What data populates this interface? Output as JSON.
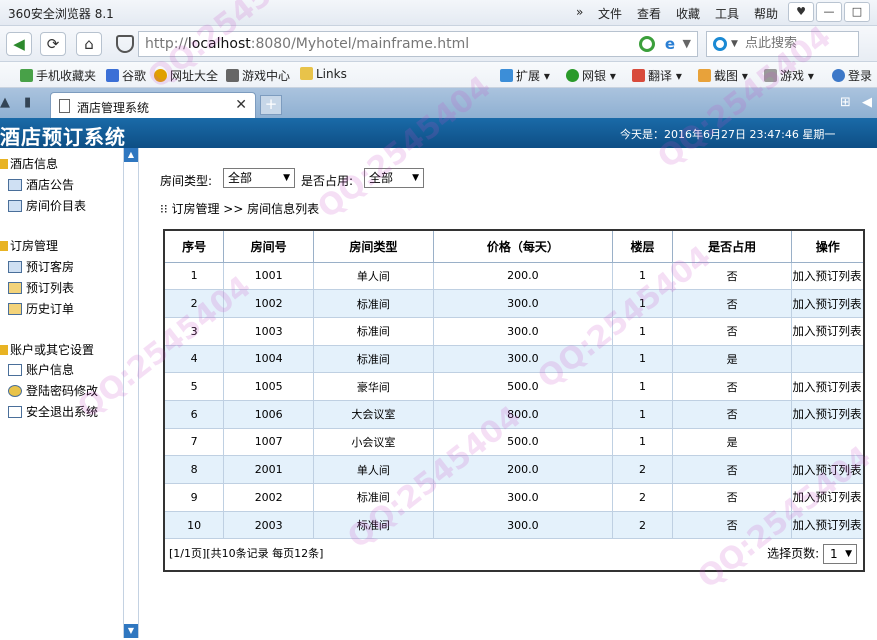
{
  "browser": {
    "title": "360安全浏览器 8.1",
    "menus": [
      "»",
      "文件",
      "查看",
      "收藏",
      "工具",
      "帮助"
    ],
    "window_buttons": [
      "♥",
      "—",
      "□"
    ],
    "url_prefix": "http://",
    "url_host": "localhost",
    "url_rest": ":8080/Myhotel/mainframe.html",
    "search_placeholder": "点此搜索",
    "bookmarks": [
      "手机收藏夹",
      "谷歌",
      "网址大全",
      "游戏中心",
      "Links",
      "扩展",
      "网银",
      "翻译",
      "截图",
      "游戏",
      "登录"
    ],
    "tab_title": "酒店管理系统",
    "new_tab": "+"
  },
  "app": {
    "system_title": "酒店预订系统",
    "date_text": "今天是：2016年6月27日   23:47:46    星期一",
    "sidebar": {
      "groups": [
        {
          "label": "酒店信息",
          "items": [
            "酒店公告",
            "房间价目表"
          ]
        },
        {
          "label": "订房管理",
          "items": [
            "预订客房",
            "预订列表",
            "历史订单"
          ]
        },
        {
          "label": "账户或其它设置",
          "items": [
            "账户信息",
            "登陆密码修改",
            "安全退出系统"
          ]
        }
      ]
    },
    "filters": {
      "room_type_label": "房间类型:",
      "room_type_value": "全部",
      "occupied_label": "是否占用:",
      "occupied_value": "全部"
    },
    "breadcrumb": "⁝⁝ 订房管理 >> 房间信息列表",
    "table": {
      "headers": [
        "序号",
        "房间号",
        "房间类型",
        "价格（每天）",
        "楼层",
        "是否占用",
        "操作"
      ],
      "rows": [
        [
          "1",
          "1001",
          "单人间",
          "200.0",
          "1",
          "否",
          "加入预订列表"
        ],
        [
          "2",
          "1002",
          "标准间",
          "300.0",
          "1",
          "否",
          "加入预订列表"
        ],
        [
          "3",
          "1003",
          "标准间",
          "300.0",
          "1",
          "否",
          "加入预订列表"
        ],
        [
          "4",
          "1004",
          "标准间",
          "300.0",
          "1",
          "是",
          ""
        ],
        [
          "5",
          "1005",
          "豪华间",
          "500.0",
          "1",
          "否",
          "加入预订列表"
        ],
        [
          "6",
          "1006",
          "大会议室",
          "800.0",
          "1",
          "否",
          "加入预订列表"
        ],
        [
          "7",
          "1007",
          "小会议室",
          "500.0",
          "1",
          "是",
          ""
        ],
        [
          "8",
          "2001",
          "单人间",
          "200.0",
          "2",
          "否",
          "加入预订列表"
        ],
        [
          "9",
          "2002",
          "标准间",
          "300.0",
          "2",
          "否",
          "加入预订列表"
        ],
        [
          "10",
          "2003",
          "标准间",
          "300.0",
          "2",
          "否",
          "加入预订列表"
        ]
      ],
      "pager_info": "[1/1页][共10条记录  每页12条]",
      "page_select_label": "选择页数:",
      "page_select_value": "1"
    }
  }
}
